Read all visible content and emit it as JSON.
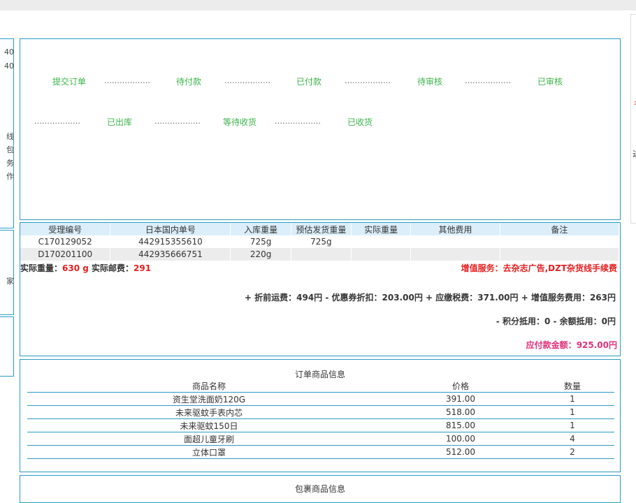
{
  "left_sidebar": {
    "panel1_lines": [
      "40",
      "40",
      "线",
      "包",
      "务",
      "作"
    ],
    "panel2_lines": [
      "家"
    ]
  },
  "right_sidebar": {
    "chars": [
      "彳",
      "进"
    ]
  },
  "order_status": {
    "steps": [
      "提交订单",
      "待付款",
      "已付款",
      "待审核",
      "已审核",
      "已出库",
      "等待收货",
      "已收货"
    ],
    "separator": "………………"
  },
  "parcels": {
    "headers": [
      "受理编号",
      "日本国内单号",
      "入库重量",
      "预估发货重量",
      "实际重量",
      "其他费用",
      "备注"
    ],
    "rows": [
      [
        "C170129052",
        "442915355610",
        "725g",
        "725g",
        "",
        "",
        ""
      ],
      [
        "D170201100",
        "442935666751",
        "220g",
        "",
        "",
        "",
        ""
      ]
    ]
  },
  "summary": {
    "actual_weight_label": "实际重量：",
    "actual_weight_value": "630 g",
    "actual_postage_label": "实际邮费：",
    "actual_postage_value": "291",
    "value_added_label": "增值服务：",
    "value_added_value": "去杂志广告,DZT杂货线手续费"
  },
  "fees": {
    "line1": "+ 折前运费：494円 - 优惠券折扣：203.00円 + 应缴税费：371.00円 + 增值服务费用：263円",
    "line2": "- 积分抵用：0 - 余额抵用：0円",
    "total_label": "应付款金额：",
    "total_value": "925.00円"
  },
  "goods": {
    "title": "订单商品信息",
    "headers": [
      "商品名称",
      "价格",
      "数量"
    ],
    "rows": [
      [
        "资生堂洗面奶120G",
        "391.00",
        "1"
      ],
      [
        "未来驱蚊手表内芯",
        "518.00",
        "1"
      ],
      [
        "未来驱蚊150日",
        "815.00",
        "1"
      ],
      [
        "面超儿童牙刷",
        "100.00",
        "4"
      ],
      [
        "立体口罩",
        "512.00",
        "2"
      ]
    ]
  },
  "bottom_section": {
    "title": "包裹商品信息"
  }
}
